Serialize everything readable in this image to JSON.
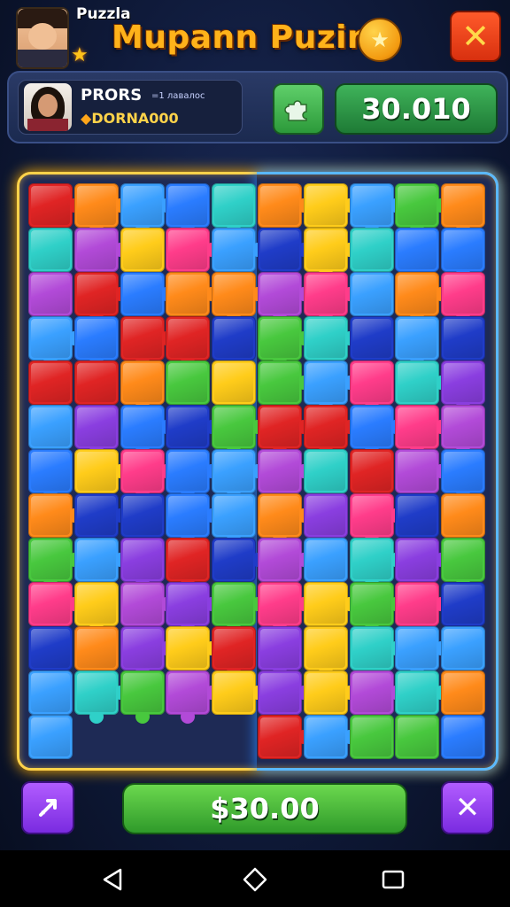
{
  "header": {
    "brand_label": "Puzzla",
    "title": "Mupann Puzin",
    "coin_icon": "star-coin-icon",
    "close_icon": "close-icon"
  },
  "player": {
    "name": "PRORS",
    "sub_label": "=1 лавалос",
    "id_label": "DORNA000",
    "diamond_glyph": "◆"
  },
  "score": {
    "value": "30.010",
    "hint_icon": "puzzle-piece-icon"
  },
  "footer": {
    "price_label": "$30.00",
    "left_icon": "swap-icon",
    "right_icon": "close-icon"
  },
  "nav": {
    "back_icon": "back-triangle-icon",
    "home_icon": "home-circle-icon",
    "recents_icon": "recents-square-icon"
  },
  "colors": {
    "accent_gold": "#ffd24a",
    "accent_blue": "#5ab8ff",
    "palette": [
      "#3aa0ff",
      "#48c83e",
      "#ff8a1a",
      "#8a3ee0",
      "#2a7cff",
      "#e02424",
      "#ffcc1a",
      "#2fd0c8",
      "#ff3c8a",
      "#1f3cc8",
      "#b24ad8"
    ]
  }
}
